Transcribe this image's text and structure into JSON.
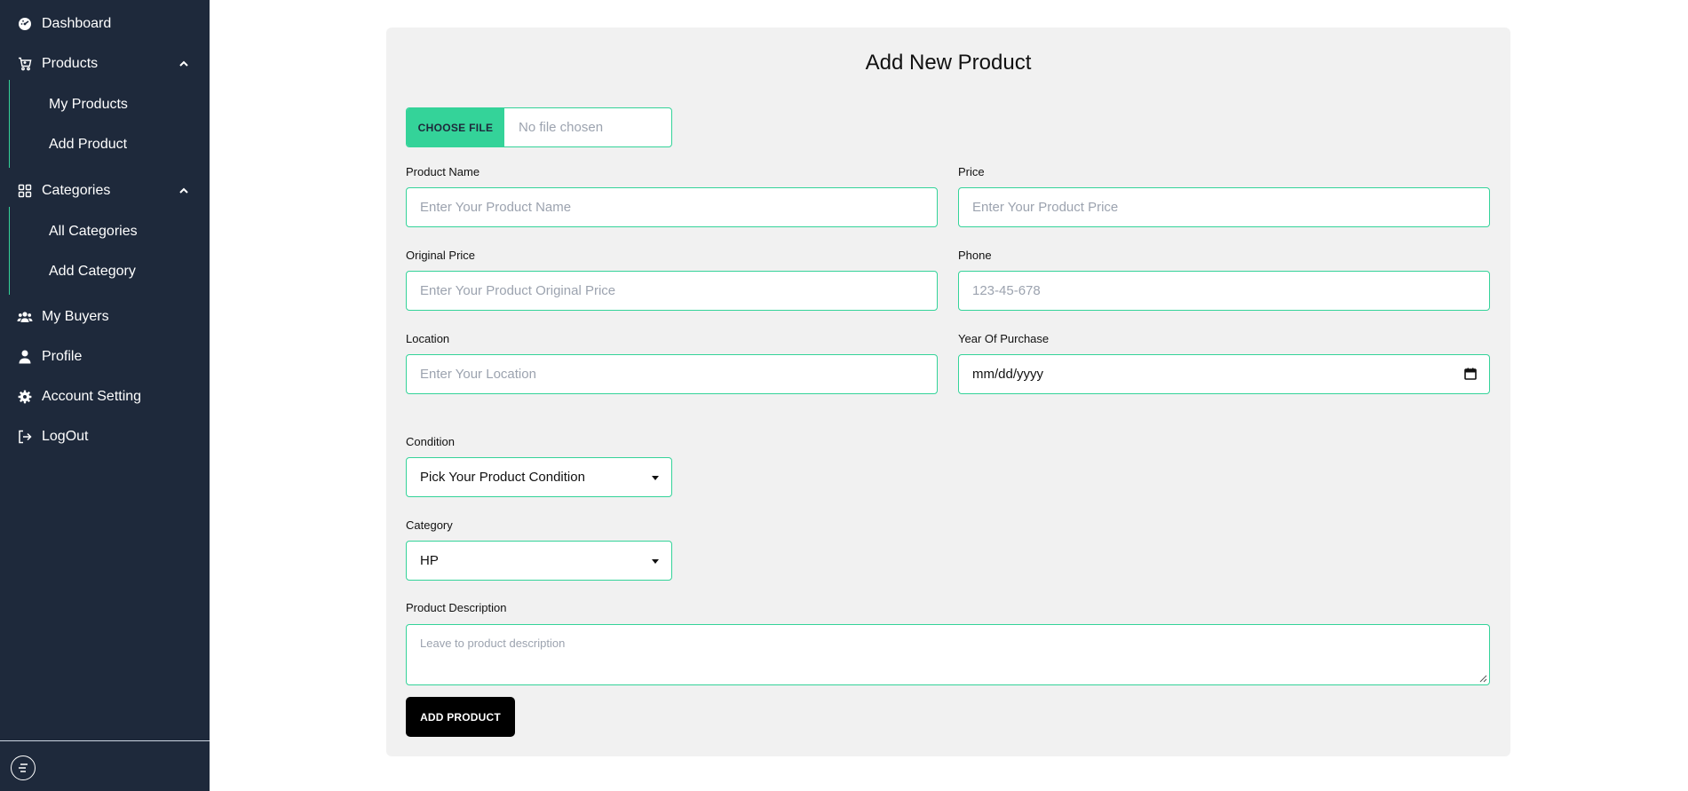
{
  "sidebar": {
    "items": [
      {
        "label": "Dashboard",
        "icon": "dashboard-icon"
      },
      {
        "label": "Products",
        "icon": "cart-icon",
        "expanded": true
      },
      {
        "label": "Categories",
        "icon": "grid-icon",
        "expanded": true
      },
      {
        "label": "My Buyers",
        "icon": "users-icon"
      },
      {
        "label": "Profile",
        "icon": "user-icon"
      },
      {
        "label": "Account Setting",
        "icon": "gear-icon"
      },
      {
        "label": "LogOut",
        "icon": "logout-icon"
      }
    ],
    "products_sub": [
      "My Products",
      "Add Product"
    ],
    "categories_sub": [
      "All Categories",
      "Add Category"
    ],
    "footer_icon": "menu-collapse-icon"
  },
  "form": {
    "title": "Add New Product",
    "file": {
      "button": "CHOOSE FILE",
      "status": "No file chosen"
    },
    "product_name": {
      "label": "Product Name",
      "placeholder": "Enter Your Product Name"
    },
    "price": {
      "label": "Price",
      "placeholder": "Enter Your Product Price"
    },
    "original_price": {
      "label": "Original Price",
      "placeholder": "Enter Your Product Original Price"
    },
    "phone": {
      "label": "Phone",
      "placeholder": "123-45-678"
    },
    "location": {
      "label": "Location",
      "placeholder": "Enter Your Location"
    },
    "year_of_purchase": {
      "label": "Year Of Purchase",
      "value": "mm/dd/yyyy"
    },
    "condition": {
      "label": "Condition",
      "selected": "Pick Your Product Condition"
    },
    "category": {
      "label": "Category",
      "selected": "HP"
    },
    "description": {
      "label": "Product Description",
      "placeholder": "Leave to product description"
    },
    "submit": "ADD PRODUCT"
  },
  "colors": {
    "sidebar_bg": "#1e293b",
    "accent": "#34d399",
    "card_bg": "#f1f1f1",
    "button_bg": "#000000"
  }
}
